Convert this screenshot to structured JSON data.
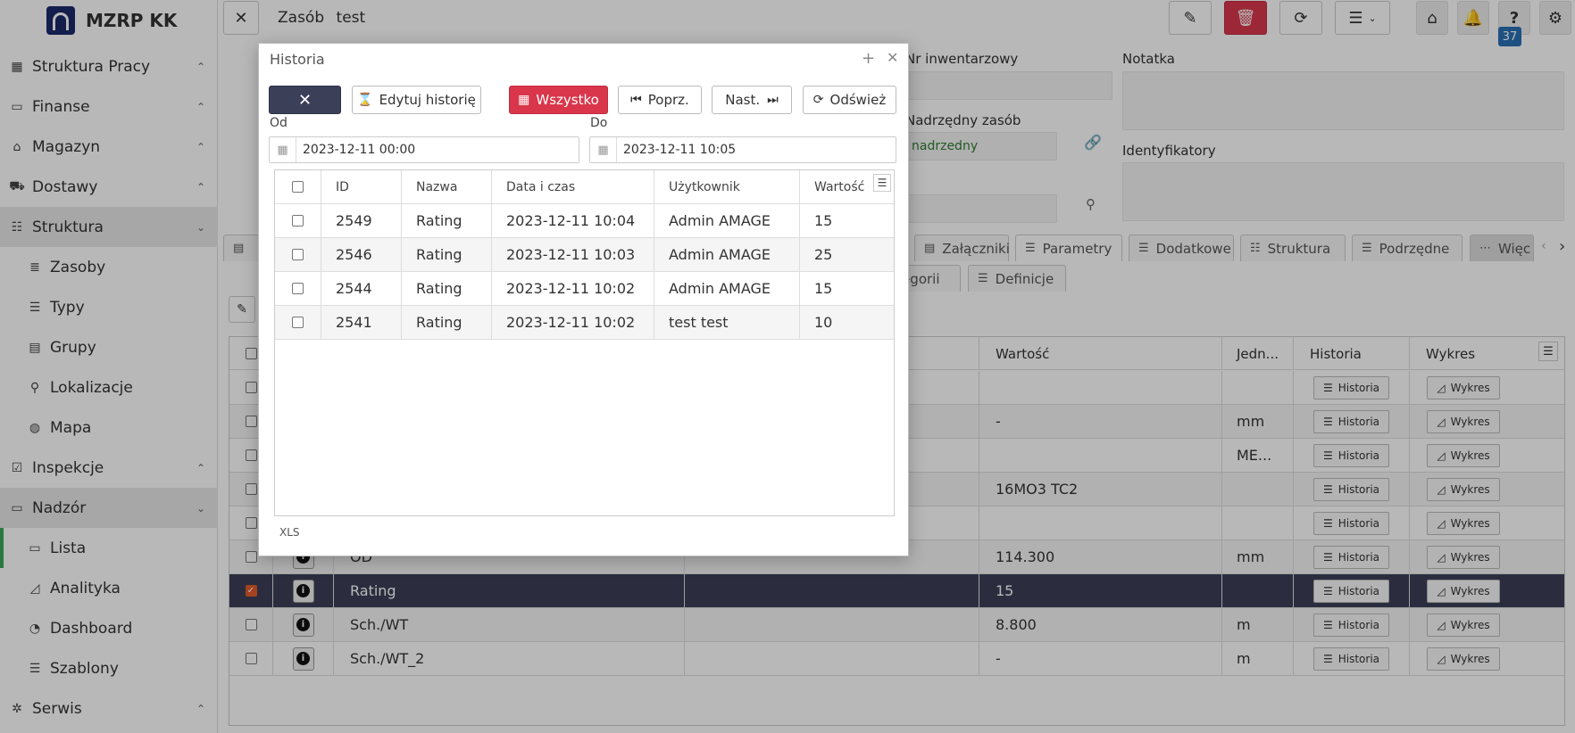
{
  "app": {
    "name": "MZRP KK"
  },
  "sidebar": {
    "items": [
      {
        "label": "Struktura Pracy",
        "icon": "building-icon",
        "chevron": "up"
      },
      {
        "label": "Finanse",
        "icon": "money-icon",
        "chevron": "up"
      },
      {
        "label": "Magazyn",
        "icon": "warehouse-icon",
        "chevron": "up"
      },
      {
        "label": "Dostawy",
        "icon": "truck-icon",
        "chevron": "up"
      },
      {
        "label": "Struktura",
        "icon": "sitemap-icon",
        "chevron": "down"
      },
      {
        "label": "Zasoby",
        "icon": "database-icon"
      },
      {
        "label": "Typy",
        "icon": "list-icon"
      },
      {
        "label": "Grupy",
        "icon": "group-icon"
      },
      {
        "label": "Lokalizacje",
        "icon": "map-marker-icon"
      },
      {
        "label": "Mapa",
        "icon": "globe-icon"
      },
      {
        "label": "Inspekcje",
        "icon": "checkbox-icon",
        "chevron": "up"
      },
      {
        "label": "Nadzór",
        "icon": "gauge-icon",
        "chevron": "down"
      },
      {
        "label": "Lista",
        "icon": "gauge-icon"
      },
      {
        "label": "Analityka",
        "icon": "area-chart-icon"
      },
      {
        "label": "Dashboard",
        "icon": "dashboard-icon"
      },
      {
        "label": "Szablony",
        "icon": "list-icon"
      },
      {
        "label": "Serwis",
        "icon": "bug-icon",
        "chevron": "up"
      }
    ]
  },
  "header": {
    "breadcrumb_prefix": "Zasób",
    "breadcrumb_value": "test",
    "notification_badge": "37"
  },
  "form": {
    "labels": {
      "nr_inwentarzowy": "Nr inwentarzowy",
      "notatka": "Notatka",
      "nadrzedny_zasob": "Nadrzędny zasób",
      "identyfikatory": "Identyfikatory",
      "nadrzedny_value": "nadrzedny"
    }
  },
  "tabs": {
    "main": [
      "Załączniki",
      "Parametry",
      "Dodatkowe",
      "Struktura",
      "Podrzędne",
      "Więc"
    ],
    "sub": [
      "ategorii",
      "Definicje"
    ]
  },
  "grid": {
    "headers": {
      "wartosc": "Wartość",
      "jedn": "Jedn...",
      "historia": "Historia",
      "wykres": "Wykres"
    },
    "button_historia": "Historia",
    "button_wykres": "Wykres",
    "rows": [
      {
        "name": "",
        "value": "",
        "unit": "",
        "checked": false
      },
      {
        "name": "",
        "value": "-",
        "unit": "mm",
        "checked": false
      },
      {
        "name": "",
        "value": "",
        "unit": "ME...",
        "checked": false
      },
      {
        "name": "",
        "value": "16MO3 TC2",
        "unit": "",
        "checked": false
      },
      {
        "name": "",
        "value": "",
        "unit": "",
        "checked": false
      },
      {
        "name": "OD",
        "value": "114.300",
        "unit": "mm",
        "checked": false
      },
      {
        "name": "Rating",
        "value": "15",
        "unit": "",
        "checked": true
      },
      {
        "name": "Sch./WT",
        "value": "8.800",
        "unit": "m",
        "checked": false
      },
      {
        "name": "Sch./WT_2",
        "value": "-",
        "unit": "m",
        "checked": false
      }
    ]
  },
  "modal": {
    "title": "Historia",
    "buttons": {
      "close": "✕",
      "edit_history": "Edytuj historię",
      "all": "Wszystko",
      "prev": "Poprz.",
      "next": "Nast.",
      "refresh": "Odśwież"
    },
    "from_label": "Od",
    "to_label": "Do",
    "from_value": "2023-12-11 00:00",
    "to_value": "2023-12-11 10:05",
    "columns": [
      "ID",
      "Nazwa",
      "Data i czas",
      "Użytkownik",
      "Wartość"
    ],
    "rows": [
      {
        "id": "2549",
        "name": "Rating",
        "datetime": "2023-12-11 10:04",
        "user": "Admin AMAGE",
        "value": "15"
      },
      {
        "id": "2546",
        "name": "Rating",
        "datetime": "2023-12-11 10:03",
        "user": "Admin AMAGE",
        "value": "25"
      },
      {
        "id": "2544",
        "name": "Rating",
        "datetime": "2023-12-11 10:02",
        "user": "Admin AMAGE",
        "value": "15"
      },
      {
        "id": "2541",
        "name": "Rating",
        "datetime": "2023-12-11 10:02",
        "user": "test test",
        "value": "10"
      }
    ],
    "export": "XLS"
  },
  "colors": {
    "danger": "#d9364b",
    "dark": "#3c3f58",
    "accent_green": "#3aaa5a",
    "badge_blue": "#2a6fb5"
  }
}
